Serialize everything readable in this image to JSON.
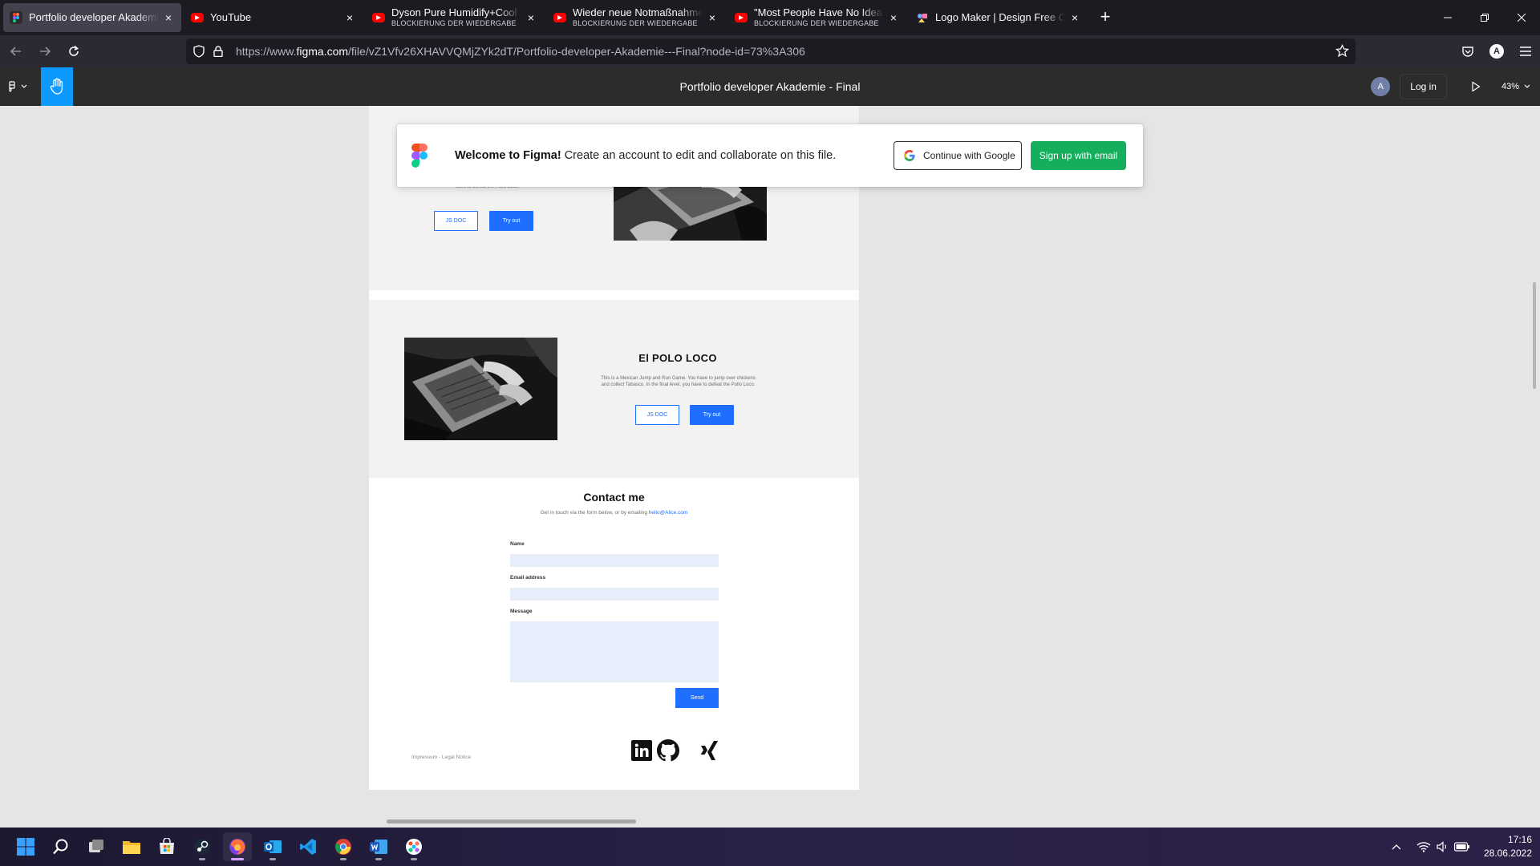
{
  "browser": {
    "tabs": [
      {
        "title": "Portfolio developer Akademie - Final",
        "subtitle": "",
        "favicon": "figma-icon",
        "active": true
      },
      {
        "title": "YouTube",
        "subtitle": "",
        "favicon": "youtube-icon",
        "active": false
      },
      {
        "title": "Dyson Pure Humidify+Cool nach",
        "subtitle": "BLOCKIERUNG DER WIEDERGABE",
        "favicon": "youtube-icon",
        "active": false
      },
      {
        "title": "Wieder neue Notmaßnahmen!",
        "subtitle": "BLOCKIERUNG DER WIEDERGABE",
        "favicon": "youtube-icon",
        "active": false
      },
      {
        "title": "\"Most People Have No Idea Wh",
        "subtitle": "BLOCKIERUNG DER WIEDERGABE",
        "favicon": "youtube-icon",
        "active": false
      },
      {
        "title": "Logo Maker | Design Free Custom",
        "subtitle": "",
        "favicon": "logo-maker-icon",
        "active": false
      }
    ],
    "close_glyph": "×",
    "new_tab_glyph": "+",
    "url_prefix": "https://www.",
    "url_domain": "figma.com",
    "url_path": "/file/vZ1Vfv26XHAVVQMjZYk2dT/Portfolio-developer-Akademie---Final?node-id=73%3A306",
    "account_initial": "A"
  },
  "figma": {
    "file_title": "Portfolio developer Akademie - Final",
    "avatar_initial": "A",
    "login_label": "Log in",
    "zoom_label": "43%"
  },
  "welcome": {
    "heading": "Welcome to Figma!",
    "message": "Create an account to edit and collaborate on this file.",
    "google_label": "Continue with Google",
    "email_label": "Sign up with email"
  },
  "design": {
    "project1": {
      "desc_tail": "have to defeat the Pollo Loco.",
      "jsdoc_label": "JS DOC",
      "tryout_label": "Try out"
    },
    "project2": {
      "title": "El POLO LOCO",
      "description": "This is a Mexican Jump and Run Game. You have to jump over chickens and collect Tabasco. In the final level, you have to defeat the Pollo Loco.",
      "jsdoc_label": "JS DOC",
      "tryout_label": "Try out"
    },
    "contact": {
      "title": "Contact me",
      "subtitle": "Get in touch via the form below, or by emailing",
      "email": "hello@Alice.com",
      "name_label": "Name",
      "email_label": "Email address",
      "message_label": "Message",
      "send_label": "Send"
    },
    "footer": {
      "impressum": "Impressum - Legal Notice"
    }
  },
  "taskbar": {
    "apps": [
      "windows-start-icon",
      "search-icon",
      "task-view-icon",
      "file-explorer-icon",
      "microsoft-store-icon",
      "steam-icon",
      "firefox-icon",
      "outlook-icon",
      "vscode-icon",
      "chrome-icon",
      "word-icon",
      "figma-icon"
    ],
    "time": "17:16",
    "date": "28.06.2022"
  },
  "colors": {
    "accent": "#1e6fff",
    "figma_blue": "#0d99ff",
    "signup_green": "#14ae5c"
  }
}
